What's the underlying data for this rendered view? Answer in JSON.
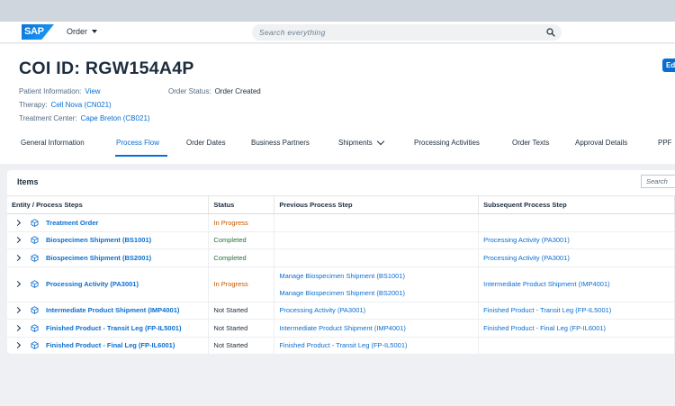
{
  "brand": {
    "logo_text": "SAP"
  },
  "shell": {
    "menu_label": "Order",
    "search_placeholder": "Search everything"
  },
  "header": {
    "title": "COI ID: RGW154A4P",
    "edit_label": "Ed",
    "patient_info_label": "Patient Information:",
    "patient_info_value": "View",
    "order_status_label": "Order Status:",
    "order_status_value": "Order Created",
    "therapy_label": "Therapy:",
    "therapy_value": "Cell Nova (CN021)",
    "treatment_center_label": "Treatment Center:",
    "treatment_center_value": "Cape Breton (CB021)"
  },
  "tabs": [
    {
      "label": "General Information"
    },
    {
      "label": "Process Flow",
      "active": true
    },
    {
      "label": "Order Dates"
    },
    {
      "label": "Business Partners"
    },
    {
      "label": "Shipments"
    },
    {
      "label": "Processing Activities"
    },
    {
      "label": "Order Texts"
    },
    {
      "label": "Approval Details"
    },
    {
      "label": "PPF"
    }
  ],
  "items": {
    "title": "Items",
    "search_placeholder": "Search",
    "columns": [
      "Entity / Process Steps",
      "Status",
      "Previous Process Step",
      "Subsequent Process Step"
    ],
    "status_colors": {
      "In Progress": "#c35500",
      "Completed": "#256f3a",
      "Not Started": "#1d2d3e"
    },
    "link_color": "#0a6ed1",
    "rows": [
      {
        "entity": "Treatment Order",
        "status": "In Progress",
        "previous": [],
        "subsequent": []
      },
      {
        "entity": "Biospecimen Shipment (BS1001)",
        "status": "Completed",
        "previous": [],
        "subsequent": [
          "Processing Activity (PA3001)"
        ]
      },
      {
        "entity": "Biospecimen Shipment (BS2001)",
        "status": "Completed",
        "previous": [],
        "subsequent": [
          "Processing Activity (PA3001)"
        ]
      },
      {
        "entity": "Processing Activity (PA3001)",
        "status": "In Progress",
        "previous": [
          "Manage Biospecimen Shipment (BS1001)",
          "Manage Biospecimen Shipment (BS2001)"
        ],
        "subsequent": [
          "Intermediate Product Shipment (IMP4001)"
        ]
      },
      {
        "entity": "Intermediate Product Shipment (IMP4001)",
        "status": "Not Started",
        "previous": [
          "Processing Activity (PA3001)"
        ],
        "subsequent": [
          "Finished Product - Transit Leg (FP-IL5001)"
        ]
      },
      {
        "entity": "Finished Product - Transit Leg (FP-IL5001)",
        "status": "Not Started",
        "previous": [
          "Intermediate Product Shipment (IMP4001)"
        ],
        "subsequent": [
          "Finished Product - Final Leg (FP-IL6001)"
        ]
      },
      {
        "entity": "Finished Product - Final Leg (FP-IL6001)",
        "status": "Not Started",
        "previous": [
          "Finished Product - Transit Leg (FP-IL5001)"
        ],
        "subsequent": []
      }
    ]
  }
}
